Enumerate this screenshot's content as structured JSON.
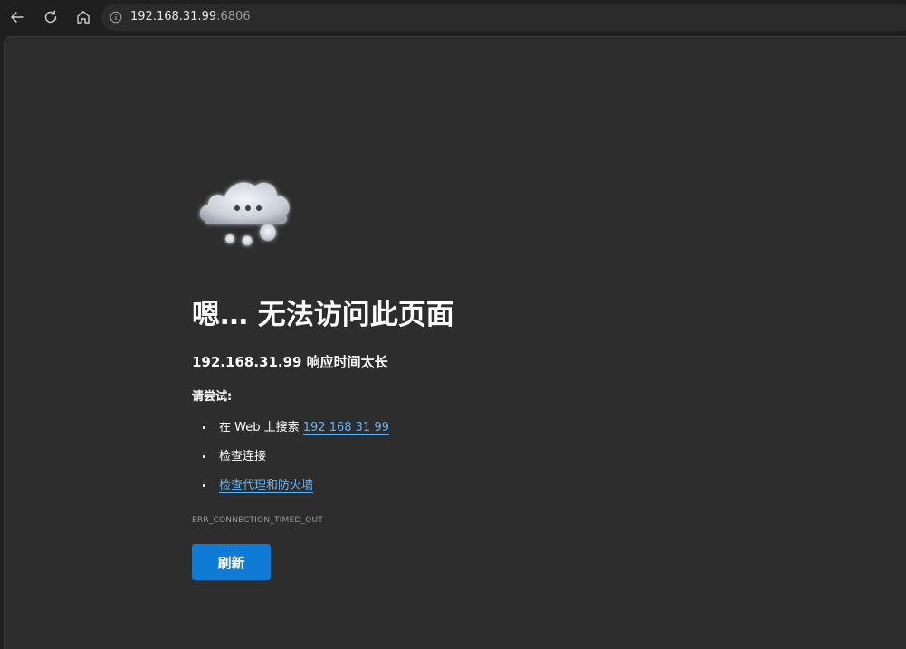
{
  "browser": {
    "url_host": "192.168.31.99",
    "url_port": ":6806",
    "icons": [
      "back-arrow-icon",
      "refresh-icon",
      "home-icon",
      "info-icon"
    ]
  },
  "error_page": {
    "title": "嗯… 无法访问此页面",
    "subtitle": "192.168.31.99 响应时间太长",
    "try_heading": "请尝试:",
    "suggestions": [
      {
        "prefix": "在 Web 上搜索 ",
        "link": "192 168 31 99"
      },
      {
        "text": "检查连接"
      },
      {
        "link": "检查代理和防火墙"
      }
    ],
    "error_code": "ERR_CONNECTION_TIMED_OUT",
    "refresh_label": "刷新"
  },
  "colors": {
    "page_background": "#2d2d2d",
    "chrome_background": "#1f1f1f",
    "link": "#64b5f6",
    "button": "#0f7bd4"
  }
}
